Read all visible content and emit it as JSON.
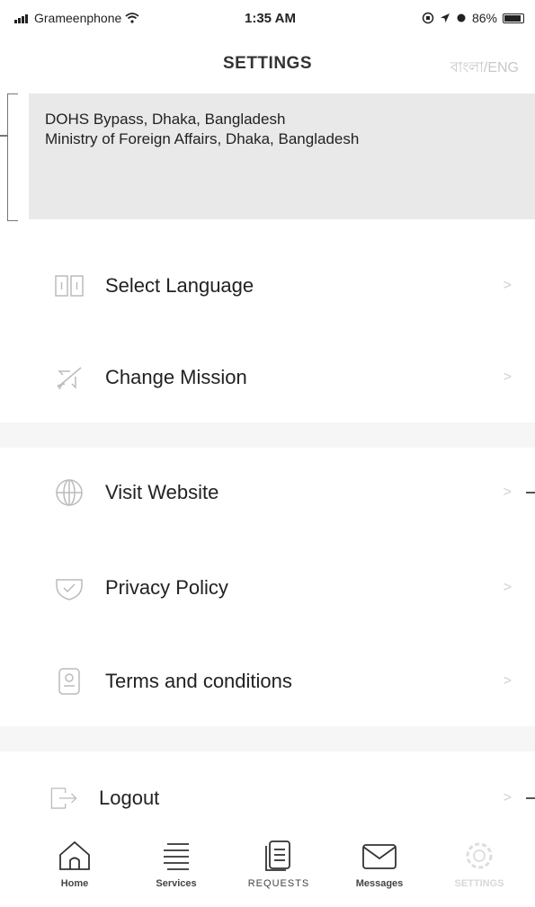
{
  "status_bar": {
    "carrier": "Grameenphone",
    "time": "1:35 AM",
    "battery": "86%"
  },
  "nav": {
    "title": "SETTINGS",
    "language_toggle": "বাংলা/ENG"
  },
  "address_card": {
    "line1": "DOHS Bypass, Dhaka, Bangladesh",
    "line2": "Ministry of Foreign Affairs, Dhaka, Bangladesh"
  },
  "menu": {
    "items": [
      {
        "label": "Select Language",
        "icon": "language-icon"
      },
      {
        "label": "Change Mission",
        "icon": "plane-icon"
      },
      {
        "label": "Visit Website",
        "icon": "globe-icon"
      },
      {
        "label": "Privacy Policy",
        "icon": "shield-icon"
      },
      {
        "label": "Terms and conditions",
        "icon": "document-icon"
      },
      {
        "label": "Logout",
        "icon": "logout-icon"
      }
    ],
    "chevron": ">"
  },
  "tab_bar": {
    "tabs": [
      {
        "label": "Home",
        "icon": "home-icon"
      },
      {
        "label": "Services",
        "icon": "list-icon"
      },
      {
        "label": "REQUESTS",
        "icon": "requests-icon"
      },
      {
        "label": "Messages",
        "icon": "mail-icon"
      },
      {
        "label": "SETTINGS",
        "icon": "gear-icon"
      }
    ]
  }
}
